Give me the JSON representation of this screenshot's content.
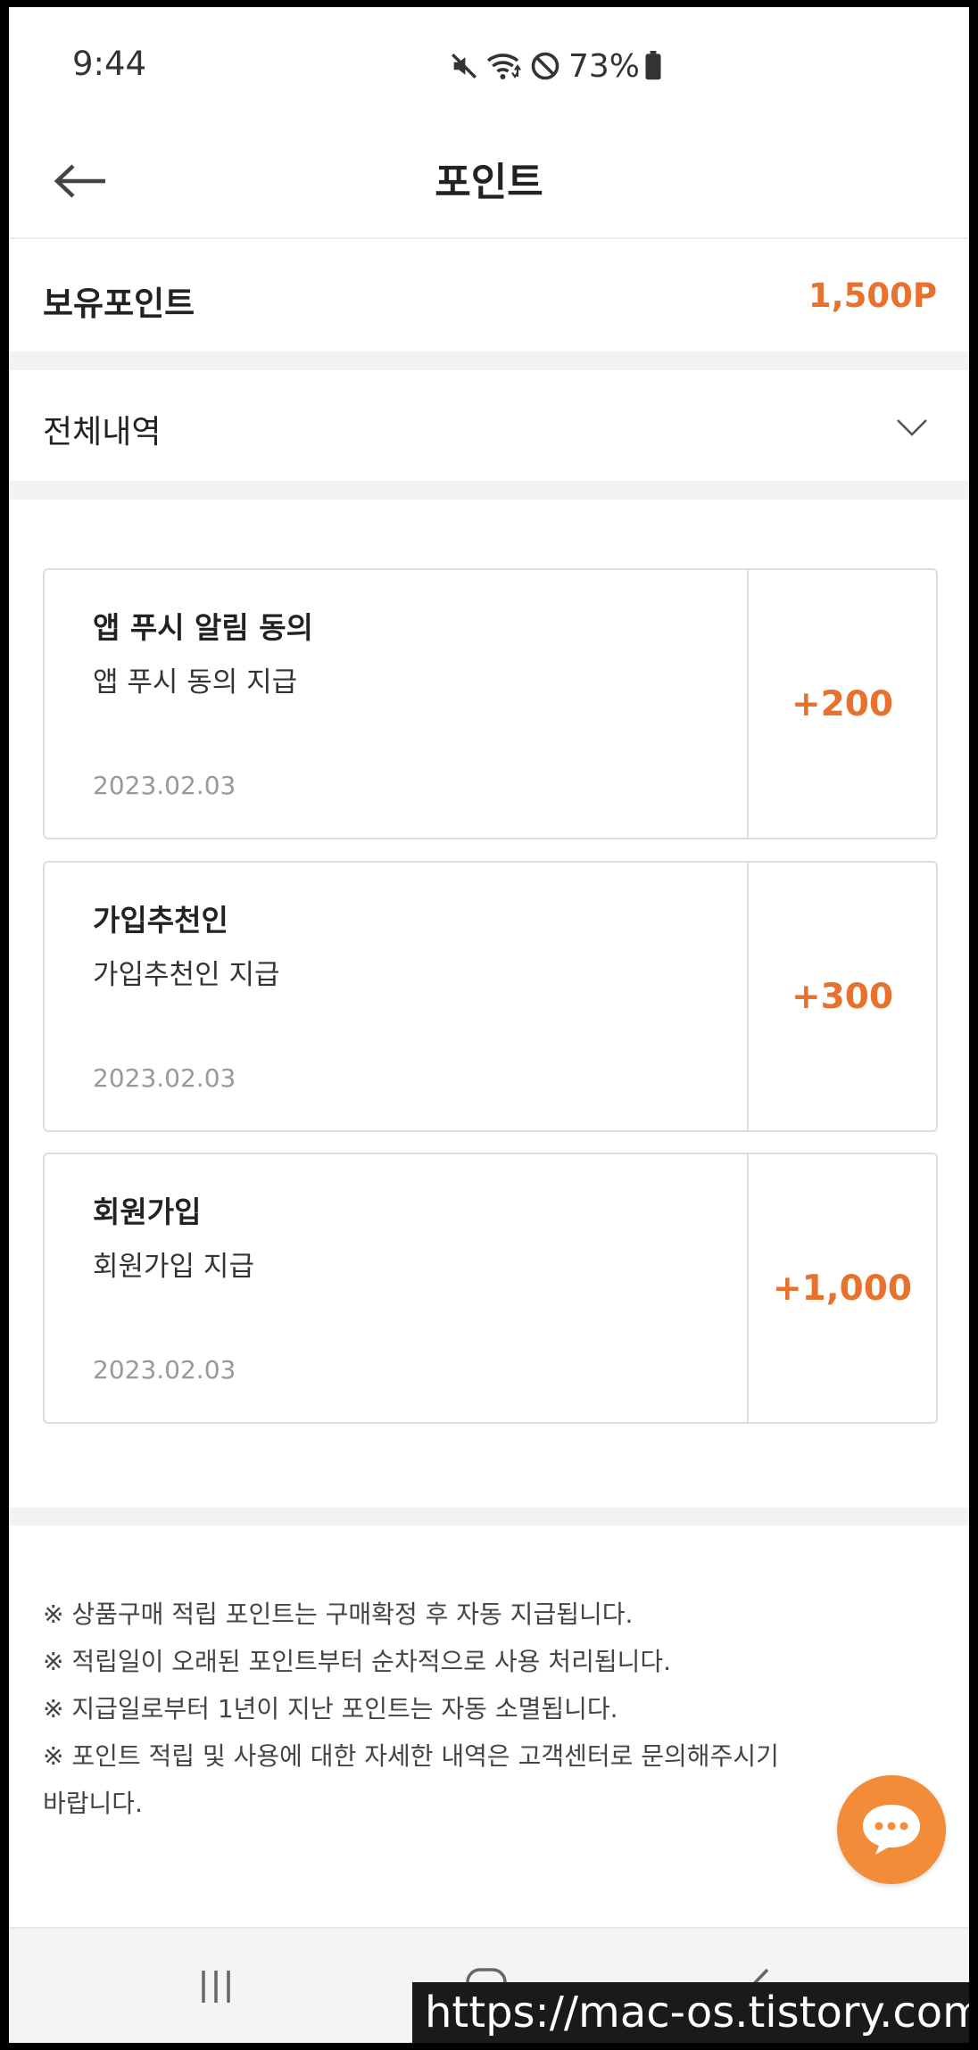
{
  "status_bar": {
    "time": "9:44",
    "battery_percent": "73%",
    "icons": [
      "mute-icon",
      "wifi-icon",
      "do-not-disturb-icon",
      "battery-icon"
    ]
  },
  "header": {
    "title": "포인트",
    "back_icon": "back-arrow-icon"
  },
  "points": {
    "label": "보유포인트",
    "value": "1,500P"
  },
  "filter": {
    "selected": "전체내역",
    "icon": "chevron-down-icon"
  },
  "history": [
    {
      "title": "앱 푸시 알림 동의",
      "description": "앱 푸시 동의 지급",
      "date": "2023.02.03",
      "amount": "+200"
    },
    {
      "title": "가입추천인",
      "description": "가입추천인 지급",
      "date": "2023.02.03",
      "amount": "+300"
    },
    {
      "title": "회원가입",
      "description": "회원가입 지급",
      "date": "2023.02.03",
      "amount": "+1,000"
    }
  ],
  "notes": [
    "※ 상품구매 적립 포인트는 구매확정 후 자동 지급됩니다.",
    "※ 적립일이 오래된 포인트부터 순차적으로 사용 처리됩니다.",
    "※ 지급일로부터 1년이 지난 포인트는 자동 소멸됩니다.",
    "※ 포인트 적립 및 사용에 대한 자세한 내역은 고객센터로 문의해주시기",
    "바랍니다."
  ],
  "chat": {
    "icon": "chat-bubble-icon"
  },
  "nav": {
    "icons": [
      "recent-apps-icon",
      "home-icon",
      "back-icon"
    ]
  },
  "watermark": "https://mac-os.tistory.com",
  "colors": {
    "accent": "#e8712d",
    "chat_button": "#f28c38",
    "divider": "#f2f2f2"
  }
}
